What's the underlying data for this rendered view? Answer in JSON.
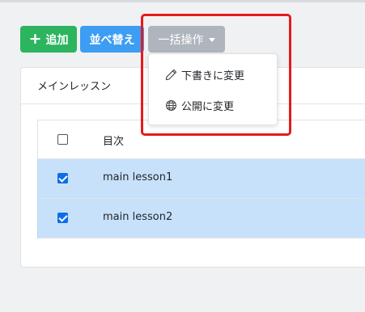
{
  "toolbar": {
    "add_label": "追加",
    "sort_label": "並べ替え",
    "bulk_label": "一括操作"
  },
  "card": {
    "title": "メインレッスン"
  },
  "table": {
    "header": "目次",
    "rows": [
      {
        "label": "main lesson1",
        "checked": true
      },
      {
        "label": "main lesson2",
        "checked": true
      }
    ]
  },
  "dropdown": {
    "items": [
      {
        "label": "下書きに変更",
        "icon": "pencil-icon"
      },
      {
        "label": "公開に変更",
        "icon": "globe-icon"
      }
    ]
  },
  "colors": {
    "add_button": "#2cb45e",
    "sort_button": "#3d9df2",
    "bulk_button": "#afb5bc",
    "selected_row": "#c8e1fb",
    "highlight": "#e41b1b"
  }
}
